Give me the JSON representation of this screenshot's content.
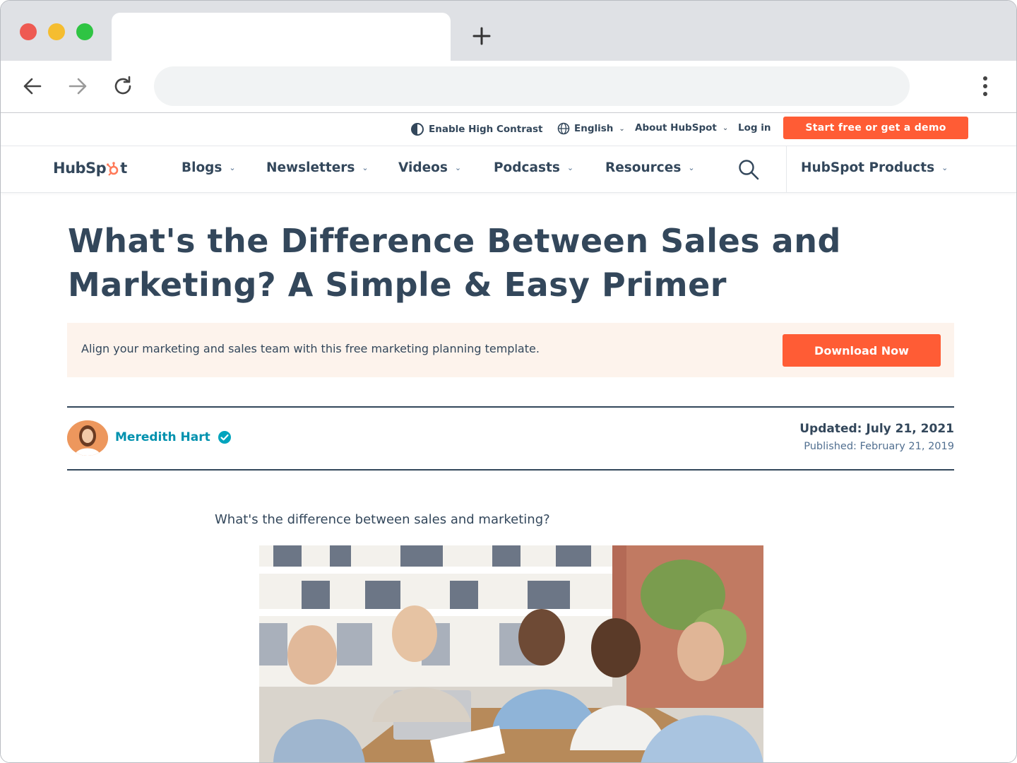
{
  "browser": {
    "address_value": "",
    "new_tab_icon": "plus-icon",
    "back_icon": "arrow-left-icon",
    "forward_icon": "arrow-right-icon",
    "reload_icon": "reload-icon",
    "menu_icon": "kebab-menu-icon"
  },
  "utility_nav": {
    "contrast_label": "Enable High Contrast",
    "language_label": "English",
    "about_label": "About HubSpot",
    "login_label": "Log in",
    "cta_label": "Start free or get a demo"
  },
  "main_nav": {
    "logo_text_a": "HubSp",
    "logo_text_b": "t",
    "items": [
      {
        "label": "Blogs"
      },
      {
        "label": "Newsletters"
      },
      {
        "label": "Videos"
      },
      {
        "label": "Podcasts"
      },
      {
        "label": "Resources"
      }
    ],
    "products_label": "HubSpot Products"
  },
  "article": {
    "title": "What's the Difference Between Sales and Marketing? A Simple & Easy Primer",
    "promo_text": "Align your marketing and sales team with this free marketing planning template.",
    "promo_button": "Download Now",
    "author": "Meredith Hart",
    "updated": "Updated: July 21, 2021",
    "published": "Published: February 21, 2019",
    "lead": "What's the difference between sales and marketing?"
  },
  "colors": {
    "brand_orange": "#ff5c35",
    "text_navy": "#33475b",
    "author_teal": "#0091ae",
    "promo_bg": "#fdf3ec"
  }
}
